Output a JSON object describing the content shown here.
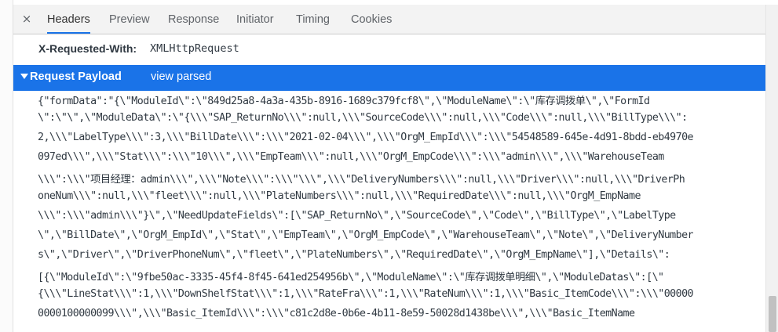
{
  "tabs": [
    {
      "label": "Headers"
    },
    {
      "label": "Preview"
    },
    {
      "label": "Response"
    },
    {
      "label": "Initiator"
    },
    {
      "label": "Timing"
    },
    {
      "label": "Cookies"
    }
  ],
  "close_glyph": "×",
  "header": {
    "name": "X-Requested-With:",
    "value": "XMLHttpRequest"
  },
  "payload": {
    "title": "Request Payload",
    "view_link": "view parsed",
    "lines": [
      "{\"formData\":\"{\\\"ModuleId\\\":\\\"849d25a8-4a3a-435b-8916-1689c379fcf8\\\",\\\"ModuleName\\\":\\\"库存调拨单\\\",\\\"FormId",
      "\\\":\\\"\\\",\\\"ModuleData\\\":\\\"{\\\\\\\"SAP_ReturnNo\\\\\\\":null,\\\\\\\"SourceCode\\\\\\\":null,\\\\\\\"Code\\\\\\\":null,\\\\\\\"BillType\\\\\\\":",
      "2,\\\\\\\"LabelType\\\\\\\":3,\\\\\\\"BillDate\\\\\\\":\\\\\\\"2021-02-04\\\\\\\",\\\\\\\"OrgM_EmpId\\\\\\\":\\\\\\\"54548589-645e-4d91-8bdd-eb4970e",
      "097ed\\\\\\\",\\\\\\\"Stat\\\\\\\":\\\\\\\"10\\\\\\\",\\\\\\\"EmpTeam\\\\\\\":null,\\\\\\\"OrgM_EmpCode\\\\\\\":\\\\\\\"admin\\\\\\\",\\\\\\\"WarehouseTeam",
      "\\\\\\\":\\\\\\\"项目经理：admin\\\\\\\",\\\\\\\"Note\\\\\\\":\\\\\\\"\\\\\\\",\\\\\\\"DeliveryNumbers\\\\\\\":null,\\\\\\\"Driver\\\\\\\":null,\\\\\\\"DriverPh",
      "oneNum\\\\\\\":null,\\\\\\\"fleet\\\\\\\":null,\\\\\\\"PlateNumbers\\\\\\\":null,\\\\\\\"RequiredDate\\\\\\\":null,\\\\\\\"OrgM_EmpName",
      "\\\\\\\":\\\\\\\"admin\\\\\\\"}\\\",\\\"NeedUpdateFields\\\":[\\\"SAP_ReturnNo\\\",\\\"SourceCode\\\",\\\"Code\\\",\\\"BillType\\\",\\\"LabelType",
      "\\\",\\\"BillDate\\\",\\\"OrgM_EmpId\\\",\\\"Stat\\\",\\\"EmpTeam\\\",\\\"OrgM_EmpCode\\\",\\\"WarehouseTeam\\\",\\\"Note\\\",\\\"DeliveryNumber",
      "s\\\",\\\"Driver\\\",\\\"DriverPhoneNum\\\",\\\"fleet\\\",\\\"PlateNumbers\\\",\\\"RequiredDate\\\",\\\"OrgM_EmpName\\\"],\\\"Details\\\":",
      "[{\\\"ModuleId\\\":\\\"9fbe50ac-3335-45f4-8f45-641ed254956b\\\",\\\"ModuleName\\\":\\\"库存调拨单明细\\\",\\\"ModuleDatas\\\":[\\\"",
      "{\\\\\\\"LineStat\\\\\\\":1,\\\\\\\"DownShelfStat\\\\\\\":1,\\\\\\\"RateFra\\\\\\\":1,\\\\\\\"RateNum\\\\\\\":1,\\\\\\\"Basic_ItemCode\\\\\\\":\\\\\\\"00000",
      "0000100000099\\\\\\\",\\\\\\\"Basic_ItemId\\\\\\\":\\\\\\\"c81c2d8e-0b6e-4b11-8e59-50028d1438be\\\\\\\",\\\\\\\"Basic_ItemName"
    ]
  }
}
